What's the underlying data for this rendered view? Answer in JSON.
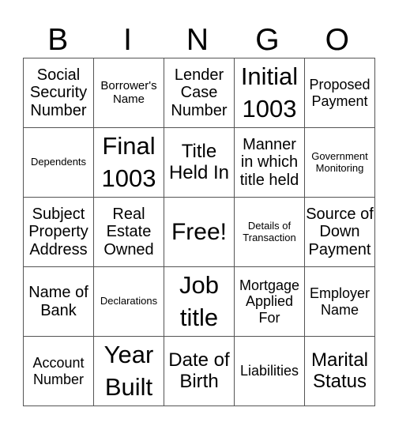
{
  "header": {
    "letters": [
      "B",
      "I",
      "N",
      "G",
      "O"
    ]
  },
  "board": {
    "rows": [
      [
        "Social Security Number",
        "Borrower's Name",
        "Lender Case Number",
        "Initial 1003",
        "Proposed Payment"
      ],
      [
        "Dependents",
        "Final 1003",
        "Title Held In",
        "Manner in which title held",
        "Government Monitoring"
      ],
      [
        "Subject Property Address",
        "Real Estate Owned",
        "Free!",
        "Details of Transaction",
        "Source of Down Payment"
      ],
      [
        "Name of Bank",
        "Declarations",
        "Job title",
        "Mortgage Applied For",
        "Employer Name"
      ],
      [
        "Account Number",
        "Year Built",
        "Date of Birth",
        "Liabilities",
        "Marital Status"
      ]
    ]
  }
}
